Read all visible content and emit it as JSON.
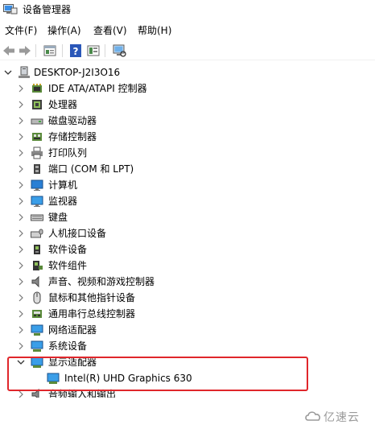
{
  "window": {
    "title": "设备管理器",
    "icon": "device-manager-icon"
  },
  "menu": [
    {
      "label": "文件(F)"
    },
    {
      "label": "操作(A)"
    },
    {
      "label": "查看(V)"
    },
    {
      "label": "帮助(H)"
    }
  ],
  "toolbar": {
    "buttons": [
      "back-arrow-icon",
      "forward-arrow-icon",
      "properties-icon",
      "help-icon",
      "grid-view-icon",
      "monitor-scan-icon"
    ]
  },
  "tree": {
    "root": {
      "label": "DESKTOP-J2I3O16",
      "expanded": true
    },
    "items": [
      {
        "label": "IDE ATA/ATAPI 控制器",
        "icon": "ide-controller-icon",
        "expanded": false
      },
      {
        "label": "处理器",
        "icon": "processor-icon",
        "expanded": false
      },
      {
        "label": "磁盘驱动器",
        "icon": "disk-drive-icon",
        "expanded": false
      },
      {
        "label": "存储控制器",
        "icon": "storage-controller-icon",
        "expanded": false
      },
      {
        "label": "打印队列",
        "icon": "printer-icon",
        "expanded": false
      },
      {
        "label": "端口 (COM 和 LPT)",
        "icon": "port-icon",
        "expanded": false
      },
      {
        "label": "计算机",
        "icon": "computer-icon",
        "expanded": false
      },
      {
        "label": "监视器",
        "icon": "monitor-icon",
        "expanded": false
      },
      {
        "label": "键盘",
        "icon": "keyboard-icon",
        "expanded": false
      },
      {
        "label": "人机接口设备",
        "icon": "hid-icon",
        "expanded": false
      },
      {
        "label": "软件设备",
        "icon": "software-device-icon",
        "expanded": false
      },
      {
        "label": "软件组件",
        "icon": "software-component-icon",
        "expanded": false
      },
      {
        "label": "声音、视频和游戏控制器",
        "icon": "speaker-icon",
        "expanded": false
      },
      {
        "label": "鼠标和其他指针设备",
        "icon": "mouse-icon",
        "expanded": false
      },
      {
        "label": "通用串行总线控制器",
        "icon": "usb-icon",
        "expanded": false
      },
      {
        "label": "网络适配器",
        "icon": "network-adapter-icon",
        "expanded": false
      },
      {
        "label": "系统设备",
        "icon": "system-device-icon",
        "expanded": false
      },
      {
        "label": "显示适配器",
        "icon": "display-adapter-icon",
        "expanded": true
      },
      {
        "label": "Intel(R) UHD Graphics 630",
        "icon": "display-adapter-icon",
        "child": true
      },
      {
        "label": "音频输入和输出",
        "icon": "audio-io-icon",
        "expanded": false
      }
    ]
  },
  "highlight": {
    "color": "#e0262b"
  },
  "watermark": {
    "text": "亿速云",
    "icon": "cloud-logo-icon"
  }
}
